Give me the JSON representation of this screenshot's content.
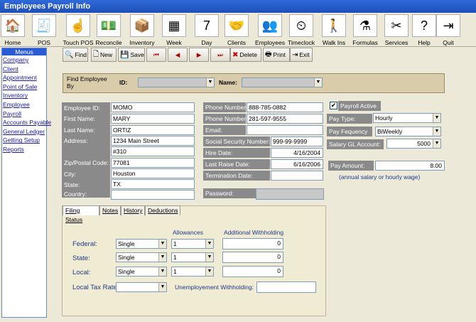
{
  "window": {
    "title": "Employees Payroll Info"
  },
  "icon_bar": [
    {
      "key": "home",
      "label": "Home",
      "icon": "house-icon",
      "glyph": "🏠"
    },
    {
      "key": "pos",
      "label": "POS",
      "icon": "cash-register-icon",
      "glyph": "🧾"
    },
    {
      "key": "touch-pos",
      "label": "Touch POS",
      "icon": "pointing-hand-icon",
      "glyph": "☝"
    },
    {
      "key": "reconcile",
      "label": "Reconcile",
      "icon": "money-icon",
      "glyph": "💵"
    },
    {
      "key": "inventory",
      "label": "Inventory",
      "icon": "boxes-icon",
      "glyph": "📦"
    },
    {
      "key": "week",
      "label": "Week",
      "icon": "calendar-grid-icon",
      "glyph": "▦"
    },
    {
      "key": "day",
      "label": "Day",
      "icon": "calendar-day-icon",
      "glyph": "7"
    },
    {
      "key": "clients",
      "label": "Clients",
      "icon": "handshake-icon",
      "glyph": "🤝"
    },
    {
      "key": "employees",
      "label": "Employees",
      "icon": "people-icon",
      "glyph": "👥"
    },
    {
      "key": "timeclock",
      "label": "Timeclock",
      "icon": "clock-box-icon",
      "glyph": "⏲"
    },
    {
      "key": "walk-ins",
      "label": "Walk Ins",
      "icon": "walking-figure-icon",
      "glyph": "🚶"
    },
    {
      "key": "formulas",
      "label": "Formulas",
      "icon": "flask-icon",
      "glyph": "⚗"
    },
    {
      "key": "services",
      "label": "Services",
      "icon": "tools-icon",
      "glyph": "✂"
    },
    {
      "key": "help",
      "label": "Help",
      "icon": "help-icon",
      "glyph": "?"
    },
    {
      "key": "quit",
      "label": "Quit",
      "icon": "exit-door-icon",
      "glyph": "⇥"
    }
  ],
  "menu": {
    "title": "Menus",
    "items": [
      "Company",
      "Client",
      "Appointment",
      "Point of Sale",
      "Inventory",
      "Employee",
      "Payroll",
      "Accounts Payable",
      "General Ledger",
      "Getting Setup",
      "Reports"
    ]
  },
  "toolbar": {
    "find": "Find",
    "new": "New",
    "save": "Save",
    "first": "⏮",
    "prev": "◀",
    "next": "▶",
    "last": "⏭",
    "delete": "Delete",
    "print": "Print",
    "exit": "Exit"
  },
  "find_panel": {
    "label": "Find Employee By",
    "id_label": "ID:",
    "name_label": "Name:"
  },
  "employee": {
    "id_label": "Employee ID:",
    "id": "MOMO",
    "first_label": "First Name:",
    "first": "MARY",
    "last_label": "Last Name:",
    "last": "ORTIZ",
    "address_label": "Address:",
    "address1": "1234 Main Street",
    "address2": "#310",
    "zip_label": "Zip/Postal Code:",
    "zip": "77081",
    "city_label": "City:",
    "city": "Houston",
    "state_label": "State:",
    "state": "TX",
    "country_label": "Country:",
    "country": ""
  },
  "contact": {
    "phone1_label": "Phone Number:",
    "phone1": "888-785-0882",
    "phone2_label": "Phone Number:",
    "phone2": "281-597-9555",
    "email_label": "Email:",
    "email": "",
    "ssn_label": "Social Security Number:",
    "ssn": "999-99-9999",
    "hire_label": "Hire Date:",
    "hire": "4/16/2004",
    "raise_label": "Last Raise Date:",
    "raise": "6/16/2006",
    "term_label": "Termination Date:",
    "term": "",
    "password_label": "Password:"
  },
  "payroll": {
    "active_label": "Payroll Active",
    "active_mark": "✔",
    "type_label": "Pay Type:",
    "type": "Hourly",
    "freq_label": "Pay Fequency",
    "freq": "BiWeekly",
    "gl_label": "Salary GL Account:",
    "gl": "5000",
    "amount_label": "Pay Amount:",
    "amount": "8.00",
    "note": "(annual salary or hourly wage)"
  },
  "tabs": [
    "Filing Status",
    "Notes",
    "History",
    "Deductions"
  ],
  "filing": {
    "allowances_header": "Allowances",
    "withholding_header": "Additional Withholding",
    "federal_label": "Federal:",
    "federal_status": "Single",
    "federal_allow": "1",
    "federal_add": "0",
    "state_label": "State:",
    "state_status": "Single",
    "state_allow": "1",
    "state_add": "0",
    "local_label": "Local:",
    "local_status": "Single",
    "local_allow": "1",
    "local_add": "0",
    "local_tax_label": "Local Tax Rate:",
    "local_tax": "",
    "unemployment_label": "Unemployement Withholding:",
    "unemployment": ""
  }
}
